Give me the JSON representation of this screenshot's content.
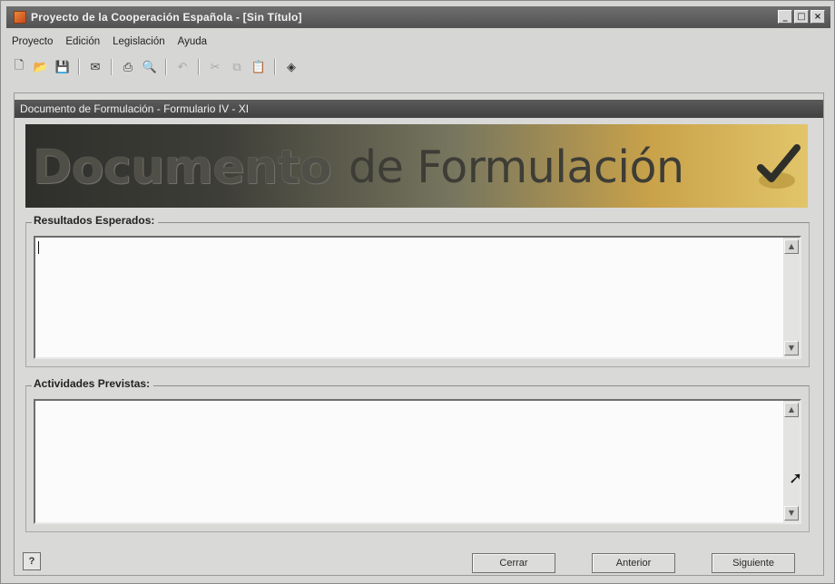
{
  "window": {
    "title": "Proyecto de la Cooperación Española - [Sin Título]"
  },
  "window_controls": {
    "minimize": "_",
    "maximize": "□",
    "close": "×"
  },
  "menu": [
    "Proyecto",
    "Edición",
    "Legislación",
    "Ayuda"
  ],
  "toolbar_icons": [
    "new-document-icon",
    "open-folder-icon",
    "save-icon",
    "mail-icon",
    "print-icon",
    "print-preview-icon",
    "undo-icon",
    "cut-icon",
    "copy-icon",
    "paste-icon",
    "book-icon"
  ],
  "panel": {
    "header": "Documento de Formulación  -  Formulario IV - XI",
    "banner_word1": "Documento",
    "banner_word2": "de Formulación"
  },
  "sections": {
    "resultados": {
      "label": "Resultados Esperados:",
      "value": ""
    },
    "actividades": {
      "label": "Actividades Previstas:",
      "value": ""
    }
  },
  "buttons": {
    "help": "?",
    "cerrar": "Cerrar",
    "anterior": "Anterior",
    "siguiente": "Siguiente"
  }
}
